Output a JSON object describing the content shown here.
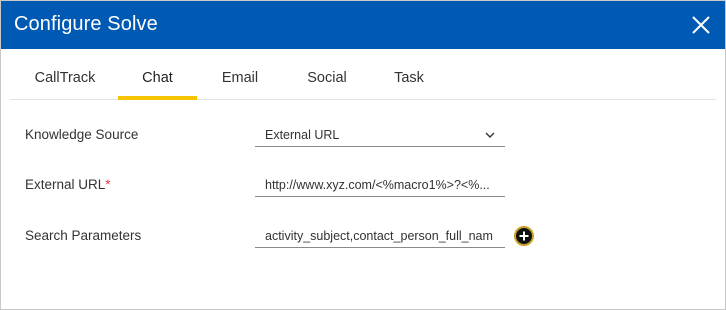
{
  "dialog": {
    "title": "Configure Solve",
    "close_icon": "close-icon"
  },
  "tabs": [
    {
      "label": "CallTrack",
      "active": false
    },
    {
      "label": "Chat",
      "active": true
    },
    {
      "label": "Email",
      "active": false
    },
    {
      "label": "Social",
      "active": false
    },
    {
      "label": "Task",
      "active": false
    }
  ],
  "form": {
    "knowledge_source": {
      "label": "Knowledge Source",
      "value": "External URL",
      "icon": "chevron-down-icon"
    },
    "external_url": {
      "label": "External URL",
      "required_mark": "*",
      "value": "http://www.xyz.com/<%macro1%>?<%..."
    },
    "search_parameters": {
      "label": "Search Parameters",
      "value": "activity_subject,contact_person_full_nam",
      "add_icon": "plus-circle-icon"
    }
  },
  "colors": {
    "header_bg": "#0059b3",
    "active_tab_underline": "#f5c400",
    "required": "#e0393e"
  }
}
